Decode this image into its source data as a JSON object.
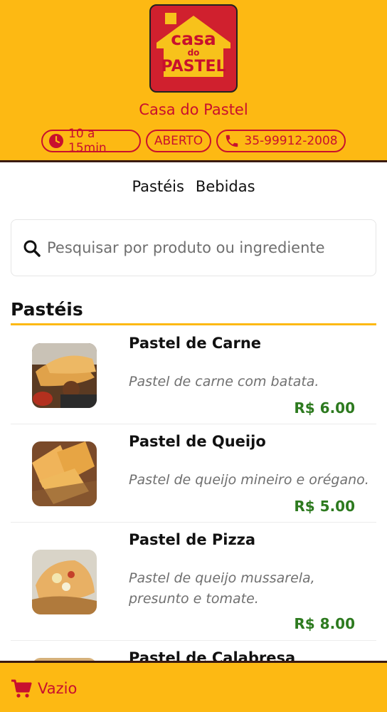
{
  "brand": {
    "logo_text_top": "casa",
    "logo_text_mid": "do",
    "logo_text_bottom": "PASTEL",
    "name": "Casa do Pastel"
  },
  "info": {
    "time": "10 a 15min",
    "status": "ABERTO",
    "phone": "35-99912-2008"
  },
  "tabs": [
    "Pastéis",
    "Bebidas"
  ],
  "search": {
    "placeholder": "Pesquisar por produto ou ingrediente",
    "value": ""
  },
  "section": {
    "title": "Pastéis"
  },
  "products": [
    {
      "name": "Pastel de Carne",
      "description": "Pastel de carne com batata.",
      "price": "R$ 6.00"
    },
    {
      "name": "Pastel de Queijo",
      "description": "Pastel de queijo mineiro e orégano.",
      "price": "R$ 5.00"
    },
    {
      "name": "Pastel de Pizza",
      "description": "Pastel de queijo mussarela, presunto e tomate.",
      "price": "R$ 8.00"
    },
    {
      "name": "Pastel de Calabresa",
      "description": "",
      "price": ""
    }
  ],
  "cart": {
    "label": "Vazio"
  },
  "colors": {
    "primary_yellow": "#FDB913",
    "brand_red": "#C8102E",
    "price_green": "#2d7a1f"
  }
}
